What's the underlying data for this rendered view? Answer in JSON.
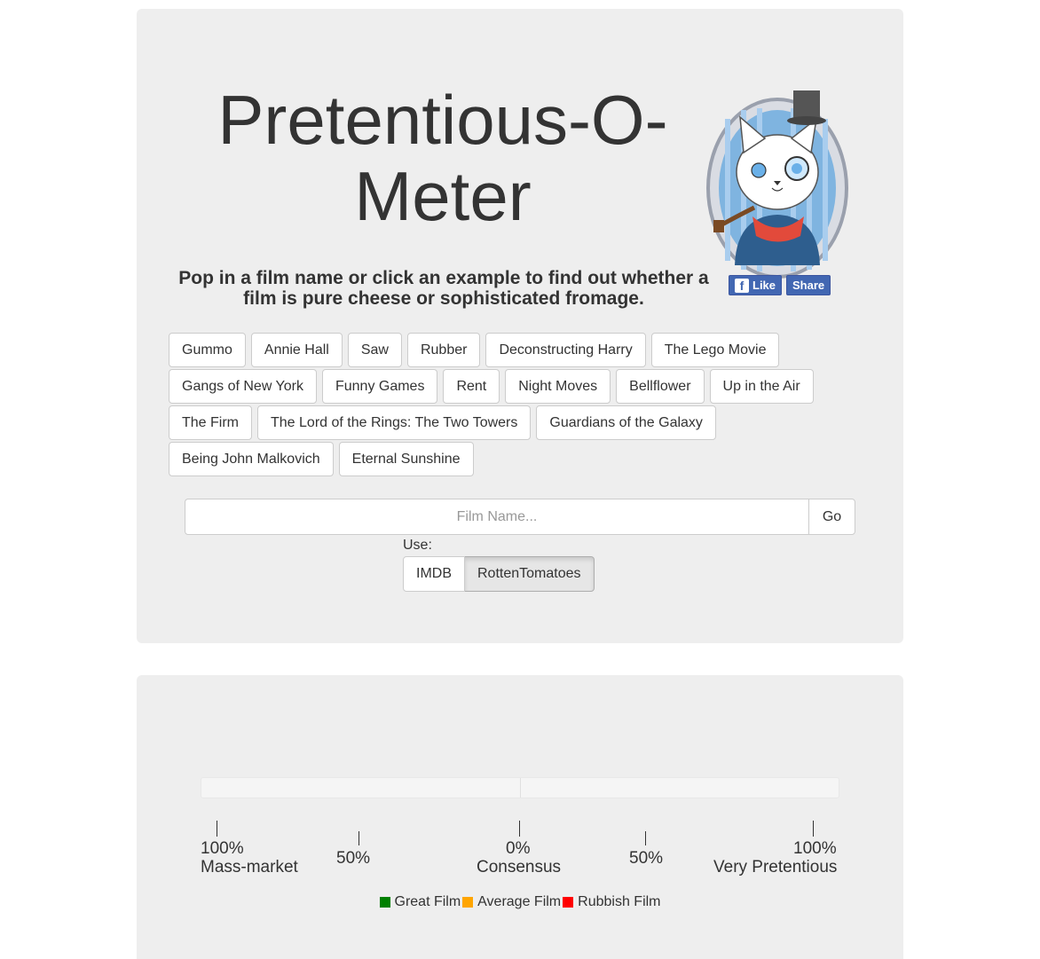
{
  "header": {
    "title": "Pretentious-O-Meter",
    "tagline": "Pop in a film name or click an example to find out whether a film is pure cheese or sophisticated fromage."
  },
  "social": {
    "like_label": "Like",
    "share_label": "Share",
    "color": "#4267b2"
  },
  "examples": [
    [
      "Gummo",
      "Annie Hall",
      "Saw",
      "Rubber",
      "Deconstructing Harry",
      "The Lego Movie"
    ],
    [
      "Gangs of New York",
      "Funny Games",
      "Rent",
      "Night Moves",
      "Bellflower",
      "Up in the Air"
    ],
    [
      "The Firm",
      "The Lord of the Rings: The Two Towers",
      "Guardians of the Galaxy"
    ],
    [
      "Being John Malkovich",
      "Eternal Sunshine"
    ]
  ],
  "search": {
    "placeholder": "Film Name...",
    "value": "",
    "go_label": "Go"
  },
  "source": {
    "label": "Use:",
    "options": [
      "IMDB",
      "RottenTomatoes"
    ],
    "selected": "RottenTomatoes"
  },
  "scale": {
    "left_pct": "100%",
    "left_name": "Mass-market",
    "left_mid_pct": "50%",
    "center_pct": "0%",
    "center_name": "Consensus",
    "right_mid_pct": "50%",
    "right_pct": "100%",
    "right_name": "Very Pretentious"
  },
  "legend": [
    {
      "label": "Great Film",
      "color": "#008000"
    },
    {
      "label": "Average Film",
      "color": "#ffa500"
    },
    {
      "label": "Rubbish Film",
      "color": "#ff0000"
    }
  ]
}
